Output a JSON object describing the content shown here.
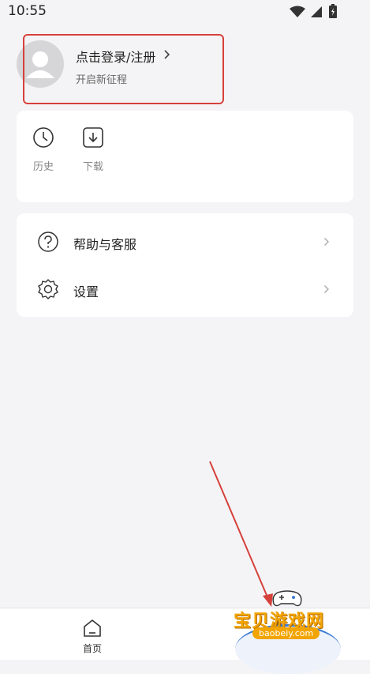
{
  "status": {
    "time": "10:55"
  },
  "profile": {
    "login_label": "点击登录/注册",
    "subtitle": "开启新征程"
  },
  "tools": [
    {
      "label": "历史",
      "icon": "clock-icon"
    },
    {
      "label": "下载",
      "icon": "download-icon"
    }
  ],
  "menu": [
    {
      "label": "帮助与客服",
      "icon": "help-icon"
    },
    {
      "label": "设置",
      "icon": "gear-icon"
    }
  ],
  "tabbar": {
    "home_label": "首页",
    "mine_label": "我的"
  },
  "watermark": {
    "title": "宝贝游戏网",
    "url": "baobeiy.com"
  },
  "colors": {
    "annotation": "#d6403a",
    "background": "#f4f4f6",
    "card": "#ffffff"
  }
}
